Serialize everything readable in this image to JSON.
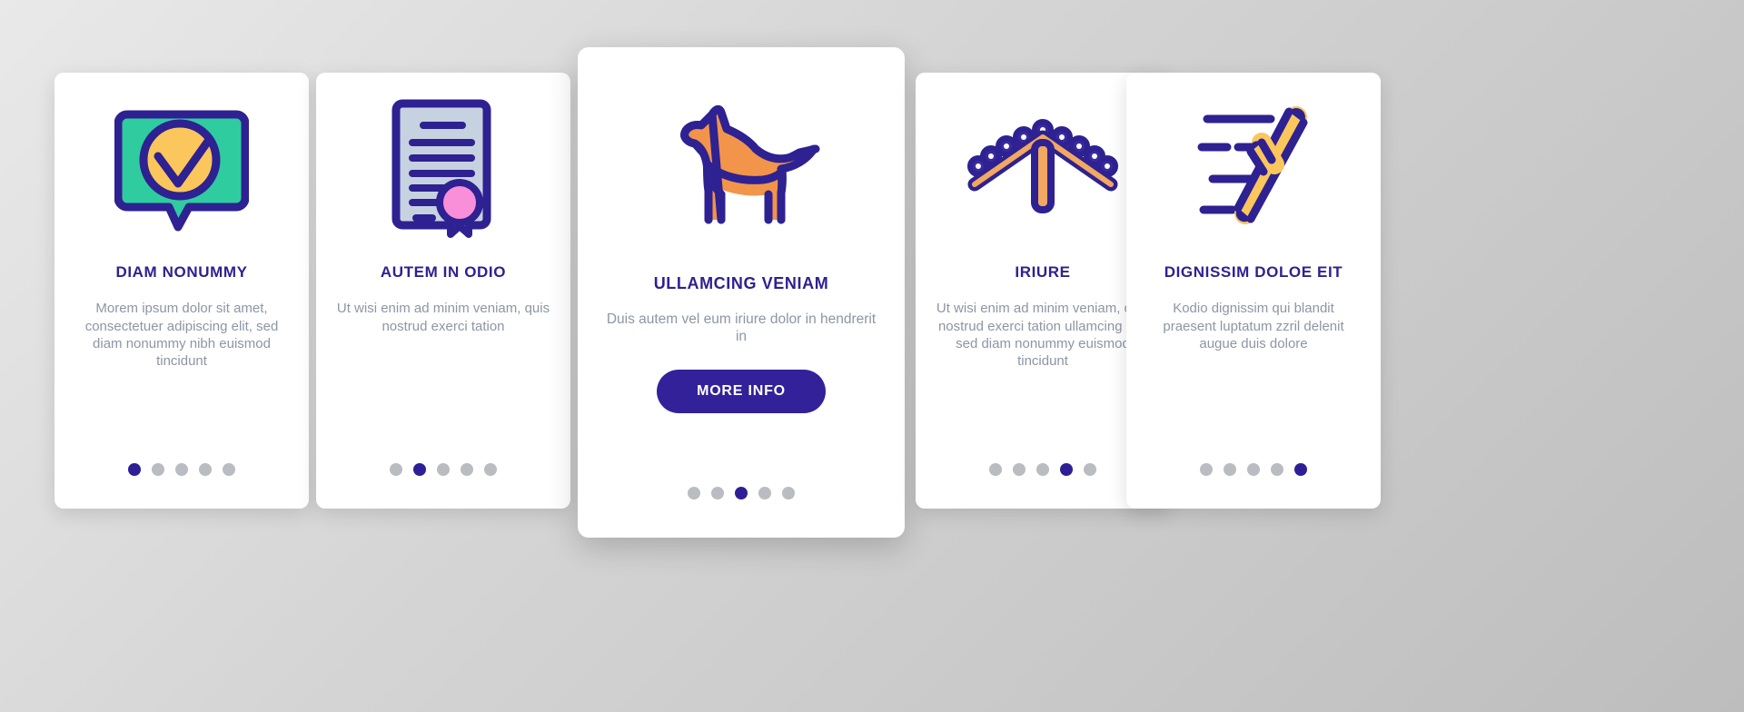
{
  "theme": {
    "purple": "#2e2191",
    "purple_button": "#33219a",
    "body_text": "#8d96a4",
    "dot_inactive": "#b9bcc0",
    "dot_active": "#2e1f96",
    "teal": "#2fcc9f",
    "orange": "#f2944a",
    "yellow": "#fbc65c",
    "pink": "#f98fd9",
    "paper": "#c7d2e0",
    "card_bg": "#ffffff"
  },
  "cards": [
    {
      "icon": "speech-bubble-check-icon",
      "title": "DIAM NONUMMY",
      "body": "Morem ipsum dolor sit amet, consectetuer adipiscing elit, sed diam nonummy nibh euismod tincidunt",
      "dots": {
        "count": 5,
        "active_index": 0
      },
      "featured": false
    },
    {
      "icon": "certificate-seal-icon",
      "title": "AUTEM IN ODIO",
      "body": "Ut wisi enim ad minim veniam, quis nostrud exerci tation",
      "dots": {
        "count": 5,
        "active_index": 1
      },
      "featured": false
    },
    {
      "icon": "dog-icon",
      "title": "ULLAMCING VENIAM",
      "body": "Duis autem vel eum iriure dolor in hendrerit in",
      "button_label": "MORE INFO",
      "dots": {
        "count": 5,
        "active_index": 2
      },
      "featured": true
    },
    {
      "icon": "agility-a-frame-icon",
      "title": "IRIURE",
      "body": "Ut wisi enim ad minim veniam, quis nostrud exerci tation ullamcing elit, sed diam nonummy euismod tincidunt",
      "dots": {
        "count": 5,
        "active_index": 3
      },
      "featured": false
    },
    {
      "icon": "throwing-stick-motion-icon",
      "title": "DIGNISSIM DOLOE EIT",
      "body": "Kodio dignissim qui blandit praesent luptatum zzril delenit augue duis dolore",
      "dots": {
        "count": 5,
        "active_index": 4
      },
      "featured": false
    }
  ]
}
